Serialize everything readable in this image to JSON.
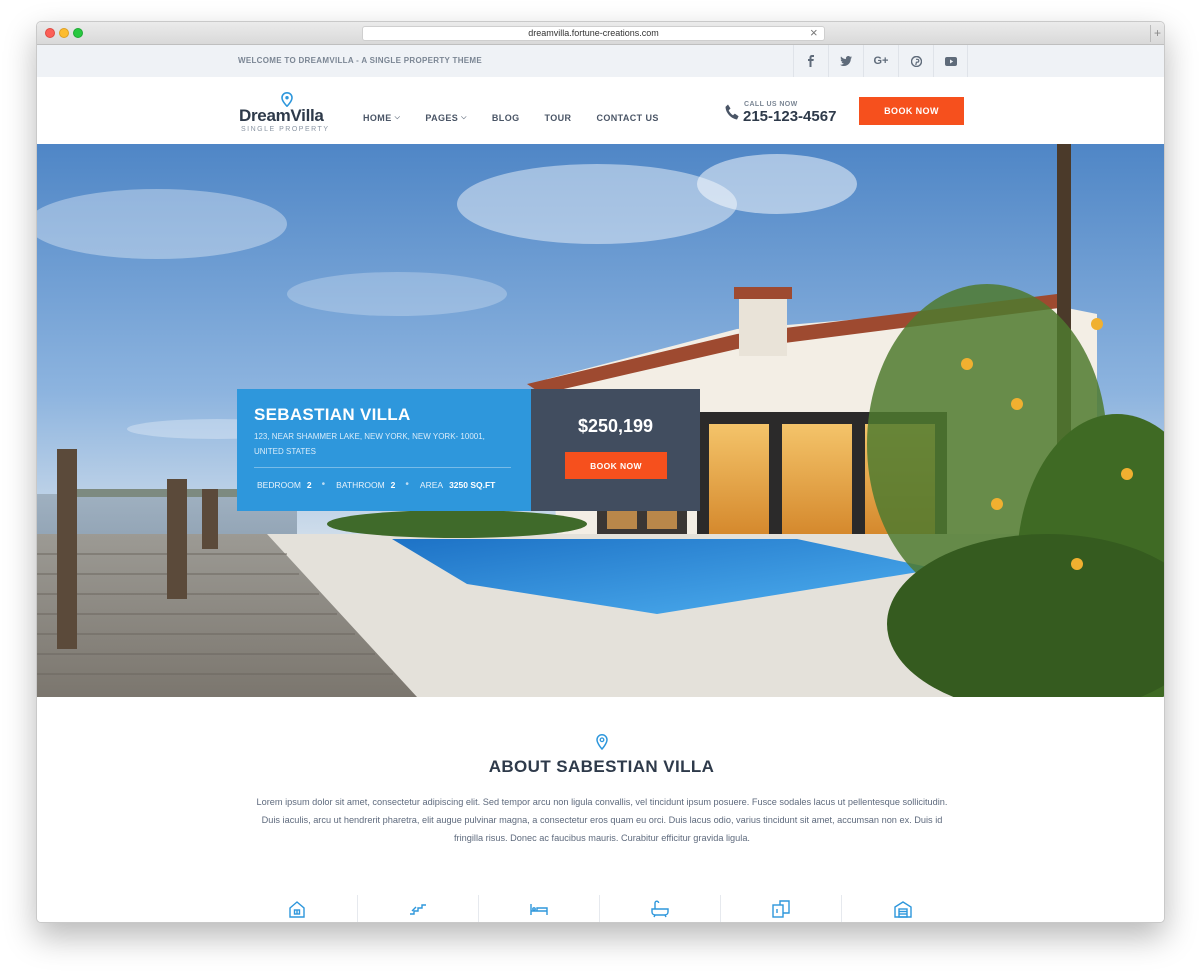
{
  "browser": {
    "url": "dreamvilla.fortune-creations.com"
  },
  "topbar": {
    "welcome": "WELCOME TO DREAMVILLA - A SINGLE PROPERTY THEME",
    "socials": [
      {
        "icon": "facebook-icon",
        "glyph": "f"
      },
      {
        "icon": "twitter-icon",
        "glyph": "🐦"
      },
      {
        "icon": "google-plus-icon",
        "glyph": "G+"
      },
      {
        "icon": "pinterest-icon",
        "glyph": "℗"
      },
      {
        "icon": "youtube-icon",
        "glyph": "▶"
      }
    ]
  },
  "header": {
    "logo_text": "DreamVilla",
    "logo_sub": "SINGLE PROPERTY",
    "nav": [
      {
        "label": "HOME",
        "dropdown": true
      },
      {
        "label": "PAGES",
        "dropdown": true
      },
      {
        "label": "BLOG",
        "dropdown": false
      },
      {
        "label": "TOUR",
        "dropdown": false
      },
      {
        "label": "CONTACT US",
        "dropdown": false
      }
    ],
    "call_label": "CALL US NOW",
    "call_number": "215-123-4567",
    "book_label": "BOOK NOW"
  },
  "hero": {
    "name": "SEBASTIAN VILLA",
    "address": "123, NEAR SHAMMER LAKE, NEW YORK, NEW YORK- 10001, UNITED STATES",
    "stats": {
      "bedroom_label": "BEDROOM",
      "bedroom_value": "2",
      "bathroom_label": "BATHROOM",
      "bathroom_value": "2",
      "area_label": "AREA",
      "area_value": "3250 SQ.FT"
    },
    "price": "$250,199",
    "book_label": "BOOK NOW"
  },
  "about": {
    "title": "ABOUT SABESTIAN VILLA",
    "text": "Lorem ipsum dolor sit amet, consectetur adipiscing elit. Sed tempor arcu non ligula convallis, vel tincidunt ipsum posuere. Fusce sodales lacus ut pellentesque sollicitudin. Duis iaculis, arcu ut hendrerit pharetra, elit augue pulvinar magna, a consectetur eros quam eu orci. Duis lacus odio, varius tincidunt sit amet, accumsan non ex. Duis id fringilla risus. Donec ac faucibus mauris. Curabitur efficitur gravida ligula.",
    "features": [
      "house-icon",
      "stairs-icon",
      "bed-icon",
      "bathtub-icon",
      "floor-plan-icon",
      "garage-icon"
    ]
  },
  "colors": {
    "accent_orange": "#f6501d",
    "accent_blue": "#2e97dc",
    "dark_slate": "#414d5f"
  }
}
